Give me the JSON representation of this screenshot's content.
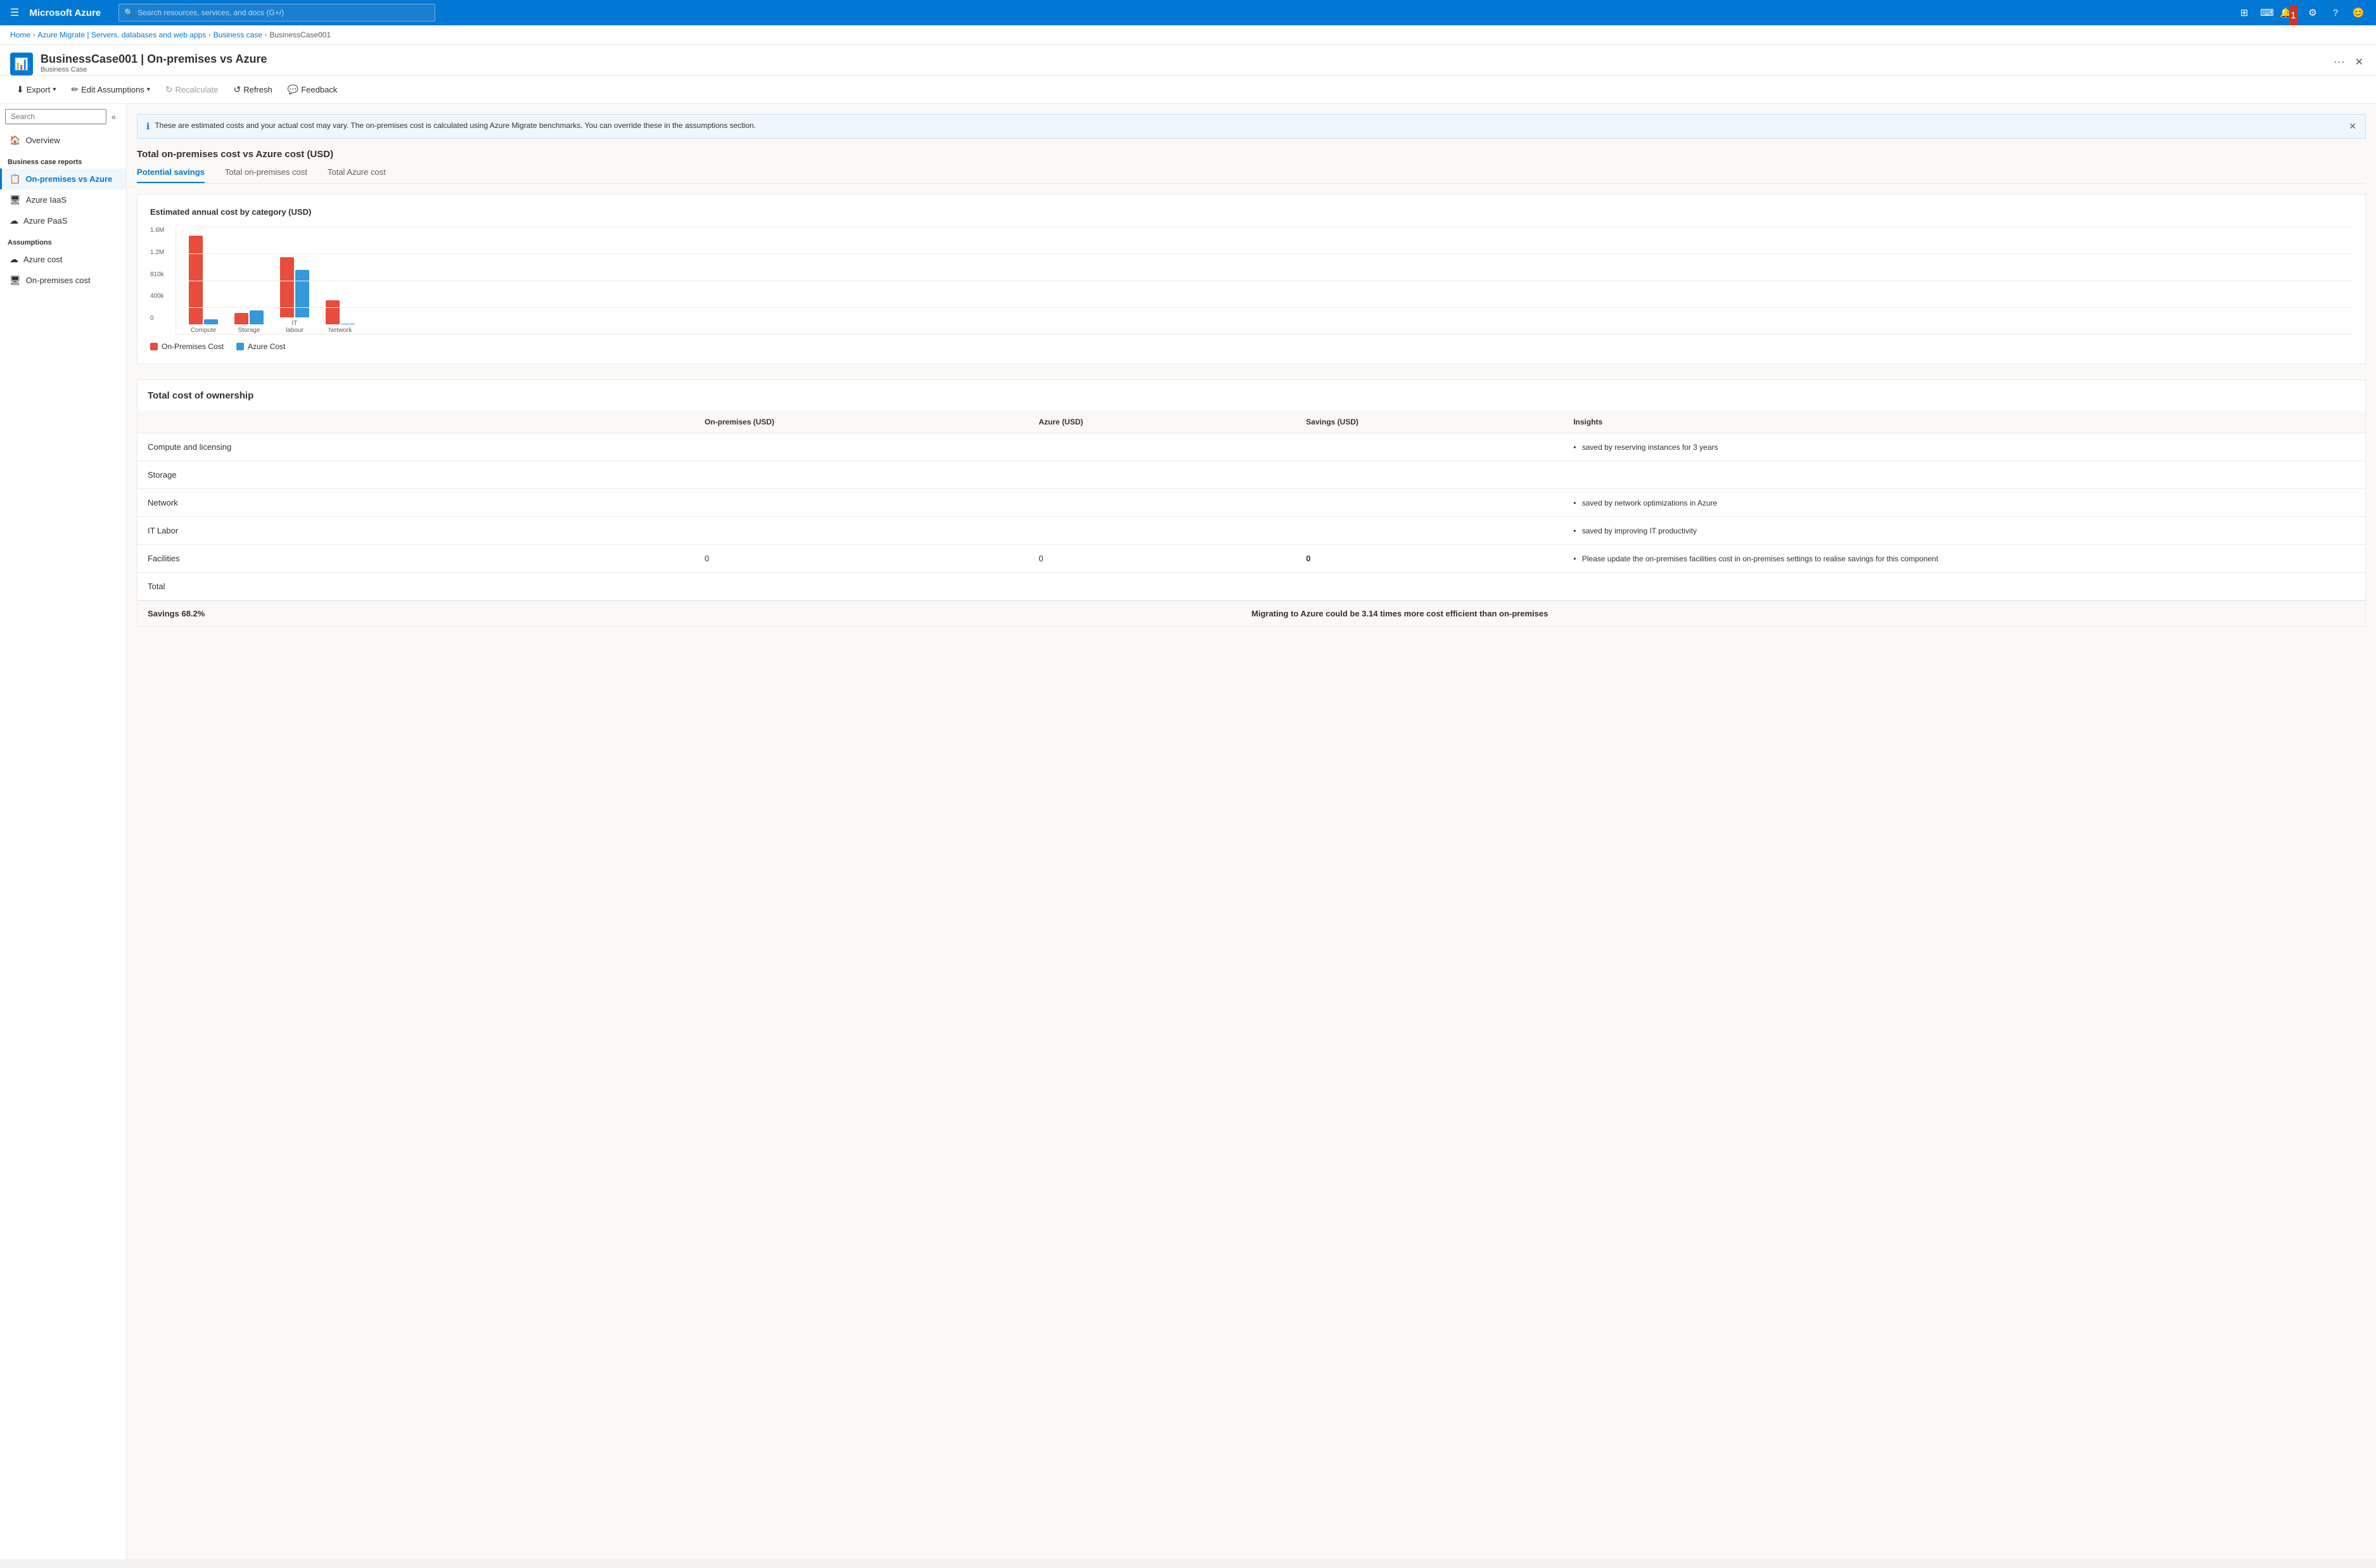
{
  "topnav": {
    "brand": "Microsoft Azure",
    "search_placeholder": "Search resources, services, and docs (G+/)",
    "notification_badge": "1"
  },
  "breadcrumb": {
    "items": [
      "Home",
      "Azure Migrate | Servers, databases and web apps",
      "Business case",
      "BusinessCase001"
    ]
  },
  "page_header": {
    "title": "BusinessCase001 | On-premises vs Azure",
    "subtitle": "Business Case"
  },
  "toolbar": {
    "export_label": "Export",
    "edit_assumptions_label": "Edit Assumptions",
    "recalculate_label": "Recalculate",
    "refresh_label": "Refresh",
    "feedback_label": "Feedback"
  },
  "info_banner": {
    "message": "These are estimated costs and your actual cost may vary. The on-premises cost is calculated using Azure Migrate benchmarks. You can override these in the assumptions section."
  },
  "main_section": {
    "title": "Total on-premises cost vs Azure cost (USD)"
  },
  "cost_tabs": [
    {
      "label": "Potential savings",
      "active": true
    },
    {
      "label": "Total on-premises cost",
      "active": false
    },
    {
      "label": "Total Azure cost",
      "active": false
    }
  ],
  "chart": {
    "title": "Estimated annual cost by category (USD)",
    "y_labels": [
      "0",
      "400k",
      "810k",
      "1.2M",
      "1.6M"
    ],
    "groups": [
      {
        "label": "Compute",
        "on_prem_height": 140,
        "azure_height": 8
      },
      {
        "label": "Storage",
        "on_prem_height": 18,
        "azure_height": 22
      },
      {
        "label": "IT\nlabour",
        "on_prem_height": 95,
        "azure_height": 75
      },
      {
        "label": "Network",
        "on_prem_height": 38,
        "azure_height": 0
      }
    ],
    "legend": [
      {
        "label": "On-Premises Cost",
        "color": "#e74c3c"
      },
      {
        "label": "Azure Cost",
        "color": "#3498db"
      }
    ]
  },
  "table": {
    "title": "Total cost of ownership",
    "columns": [
      "",
      "On-premises (USD)",
      "Azure (USD)",
      "Savings (USD)",
      "Insights"
    ],
    "rows": [
      {
        "name": "Compute and licensing",
        "on_prem": "",
        "azure": "",
        "savings": "",
        "insight": "saved by reserving instances for 3 years"
      },
      {
        "name": "Storage",
        "on_prem": "",
        "azure": "",
        "savings": "",
        "insight": ""
      },
      {
        "name": "Network",
        "on_prem": "",
        "azure": "",
        "savings": "",
        "insight": "saved by network optimizations in Azure"
      },
      {
        "name": "IT Labor",
        "on_prem": "",
        "azure": "",
        "savings": "",
        "insight": "saved by improving IT productivity"
      },
      {
        "name": "Facilities",
        "on_prem": "0",
        "azure": "0",
        "savings": "0",
        "insight": "Please update the on-premises facilities cost in on-premises settings to realise savings for this component"
      },
      {
        "name": "Total",
        "on_prem": "",
        "azure": "",
        "savings": "",
        "insight": ""
      }
    ]
  },
  "footer": {
    "savings_pct": "Savings 68.2%",
    "efficiency_note": "Migrating to Azure could be 3.14 times more cost efficient than on-premises"
  },
  "sidebar": {
    "search_placeholder": "Search",
    "overview_label": "Overview",
    "business_case_reports_title": "Business case reports",
    "nav_items": [
      {
        "label": "On-premises vs Azure",
        "active": true,
        "icon": "📋"
      },
      {
        "label": "Azure IaaS",
        "active": false,
        "icon": "🖥"
      },
      {
        "label": "Azure PaaS",
        "active": false,
        "icon": "☁"
      }
    ],
    "assumptions_title": "Assumptions",
    "assumption_items": [
      {
        "label": "Azure cost",
        "icon": "☁"
      },
      {
        "label": "On-premises cost",
        "icon": "🖥"
      }
    ]
  }
}
